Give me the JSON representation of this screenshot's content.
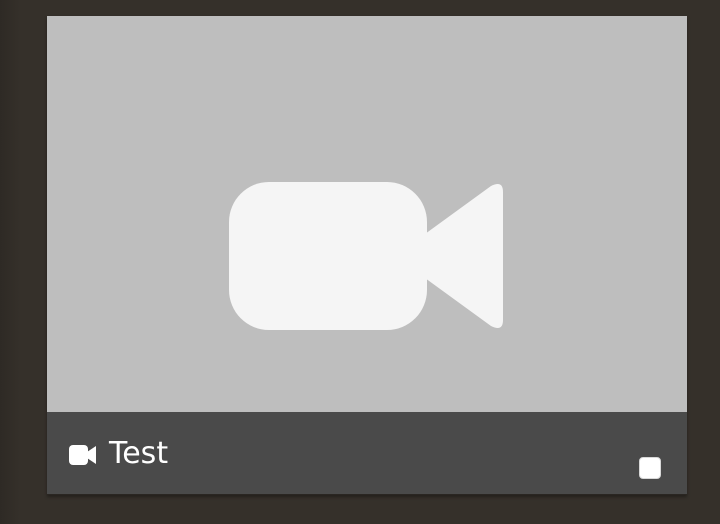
{
  "video_card": {
    "title": "Test",
    "thumbnail_icon": "video-camera-icon",
    "type_icon": "video-camera-icon",
    "selected": false
  },
  "colors": {
    "background": "#35302a",
    "thumbnail_bg": "#bebebe",
    "thumbnail_icon": "#f5f5f5",
    "footer_bg": "#4a4a4a",
    "title_text": "#ffffff"
  }
}
